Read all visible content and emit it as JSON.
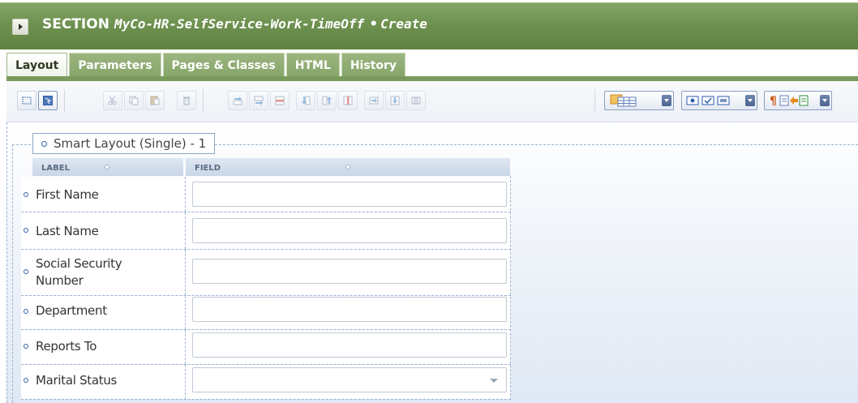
{
  "header": {
    "keyword": "SECTION",
    "rule_name": "MyCo-HR-SelfService-Work-TimeOff",
    "bullet": "•",
    "status": "Create"
  },
  "tabs": [
    {
      "label": "Layout",
      "active": true
    },
    {
      "label": "Parameters",
      "active": false
    },
    {
      "label": "Pages & Classes",
      "active": false
    },
    {
      "label": "HTML",
      "active": false
    },
    {
      "label": "History",
      "active": false
    }
  ],
  "toolbar": {
    "icons": [
      "select-mode-icon",
      "select-all-icon",
      "cut-icon",
      "copy-icon",
      "paste-icon",
      "delete-icon",
      "insert-row-before-icon",
      "insert-row-after-icon",
      "delete-row-icon",
      "insert-column-before-icon",
      "insert-column-after-icon",
      "delete-column-icon",
      "move-right-icon",
      "move-down-icon",
      "merge-columns-icon",
      "layout-dropdown-icon",
      "basic-controls-dropdown-icon",
      "advanced-controls-dropdown-icon"
    ]
  },
  "smart_layout": {
    "title": "Smart Layout (Single) - 1",
    "label_header": "LABEL",
    "field_header": "FIELD",
    "rows": [
      {
        "label": "First Name",
        "control": "text"
      },
      {
        "label": "Last Name",
        "control": "text"
      },
      {
        "label_line1": "Social Security",
        "label_line2": "Number",
        "control": "text"
      },
      {
        "label": "Department",
        "control": "text"
      },
      {
        "label": "Reports To",
        "control": "text"
      },
      {
        "label": "Marital Status",
        "control": "dropdown"
      }
    ]
  },
  "colors": {
    "header_green": "#6e9150",
    "tab_green": "#86a56a",
    "layout_blue": "#2f5faa"
  }
}
